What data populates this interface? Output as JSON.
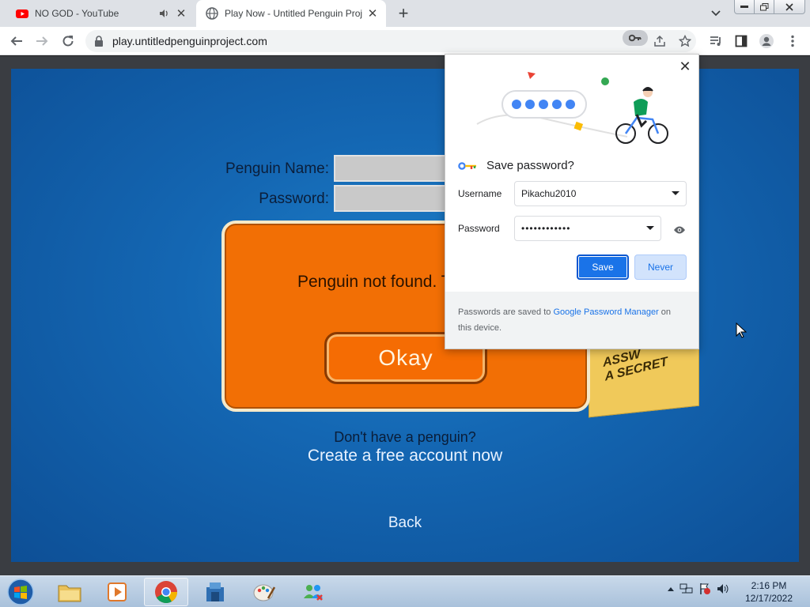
{
  "browser": {
    "tabs": [
      {
        "title": "NO GOD - YouTube",
        "favicon": "youtube-icon",
        "audio": true,
        "active": false
      },
      {
        "title": "Play Now - Untitled Penguin Proj",
        "favicon": "globe-icon",
        "active": true
      }
    ],
    "url": "play.untitledpenguinproject.com"
  },
  "page": {
    "penguin_name_label": "Penguin Name:",
    "password_label": "Password:",
    "error_message": "Penguin not found. T",
    "okay_label": "Okay",
    "note_text_line1": "ASSW",
    "note_text_line2": "A SECRET",
    "signup_question": "Don't have a penguin?",
    "signup_link": "Create a free account now",
    "back_label": "Back"
  },
  "save_password": {
    "title": "Save password?",
    "username_label": "Username",
    "username_value": "Pikachu2010",
    "password_label": "Password",
    "password_value": "••••••••••••",
    "save_label": "Save",
    "never_label": "Never",
    "footer_before": "Passwords are saved to ",
    "footer_link": "Google Password Manager",
    "footer_after": " on this device."
  },
  "taskbar": {
    "apps": [
      "explorer-icon",
      "media-player-icon",
      "chrome-icon",
      "app-icon",
      "paint-icon",
      "network-people-icon"
    ],
    "time": "2:16 PM",
    "date": "12/17/2022"
  },
  "colors": {
    "accent": "#1a73e8",
    "game_blue": "#1467b3",
    "error_orange": "#f26f05"
  }
}
